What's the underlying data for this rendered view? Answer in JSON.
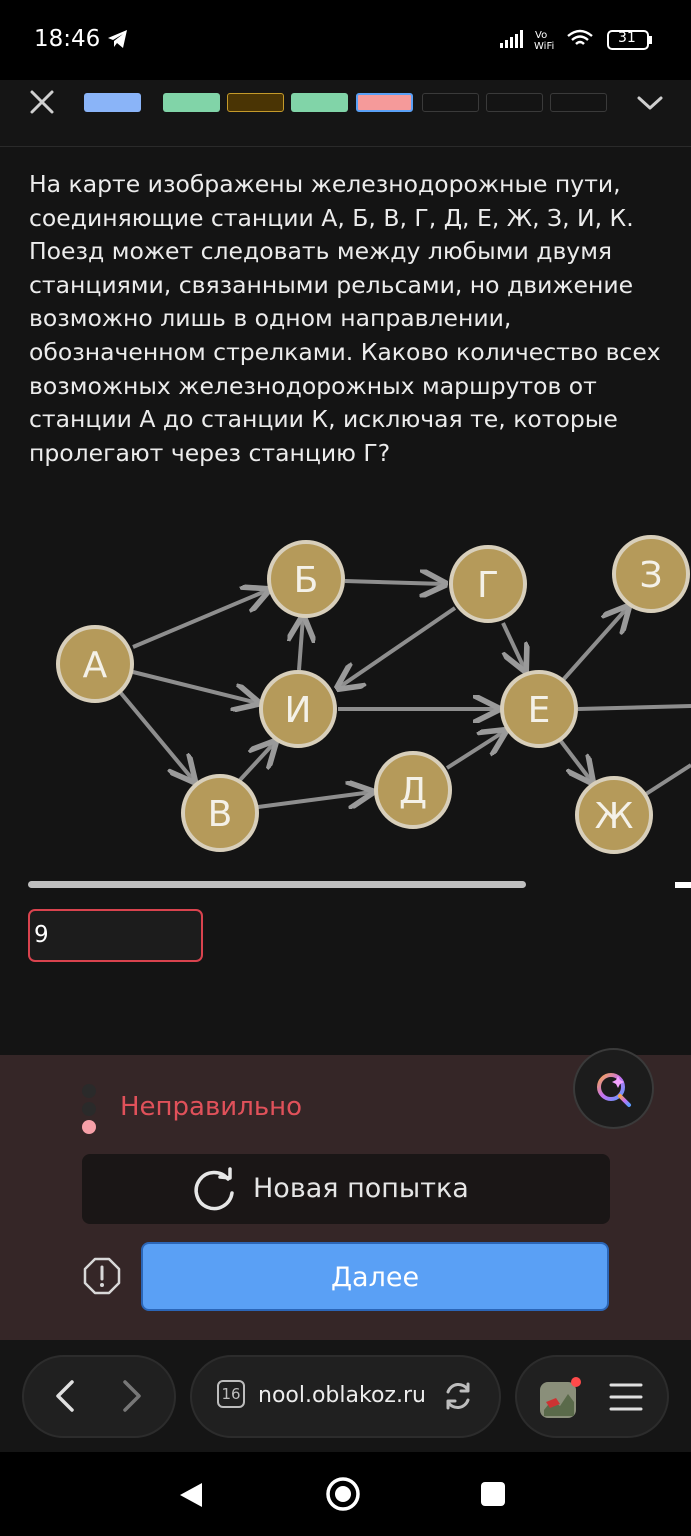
{
  "status": {
    "time": "18:46",
    "network": "Vo WiFi",
    "battery": "31"
  },
  "header": {
    "progress": [
      {
        "state": "current-view",
        "color": "#8ab4f8"
      },
      {
        "state": "correct",
        "color": "#81d4a8"
      },
      {
        "state": "pending",
        "color": "#4a3404"
      },
      {
        "state": "correct",
        "color": "#81d4a8"
      },
      {
        "state": "wrong",
        "color": "#f59a9a"
      },
      {
        "state": "empty",
        "color": "#141414"
      },
      {
        "state": "empty",
        "color": "#141414"
      },
      {
        "state": "empty",
        "color": "#141414"
      }
    ]
  },
  "question": {
    "text": "На карте изображены железнодорожные пути, соединяющие станции А, Б, В, Г, Д, Е, Ж, З, И, К. Поезд может следовать между любыми двумя станциями, связанными рельсами, но движение возможно лишь в одном направлении, обозначенном стрелками. Каково количество всех возможных железнодорожных маршрутов от станции А до станции К, исключая те, которые пролегают через станцию Г?"
  },
  "graph": {
    "stations": [
      "А",
      "Б",
      "В",
      "Г",
      "Д",
      "Е",
      "Ж",
      "З",
      "И"
    ],
    "edges": [
      [
        "А",
        "Б"
      ],
      [
        "А",
        "И"
      ],
      [
        "А",
        "В"
      ],
      [
        "В",
        "И"
      ],
      [
        "В",
        "Д"
      ],
      [
        "И",
        "Б"
      ],
      [
        "Б",
        "Г"
      ],
      [
        "Г",
        "И"
      ],
      [
        "Г",
        "Е"
      ],
      [
        "И",
        "Е"
      ],
      [
        "Д",
        "Е"
      ],
      [
        "Е",
        "З"
      ],
      [
        "Е",
        "Ж"
      ]
    ]
  },
  "answer": {
    "value": "9"
  },
  "feedback": {
    "verdict": "Неправильно",
    "retry_label": "Новая попытка",
    "next_label": "Далее"
  },
  "browser": {
    "url": "nool.oblakoz.ru",
    "tab_count": "16"
  },
  "colors": {
    "station_fill": "#b59a5a",
    "accent": "#5aa0f5",
    "error": "#d9434e"
  }
}
